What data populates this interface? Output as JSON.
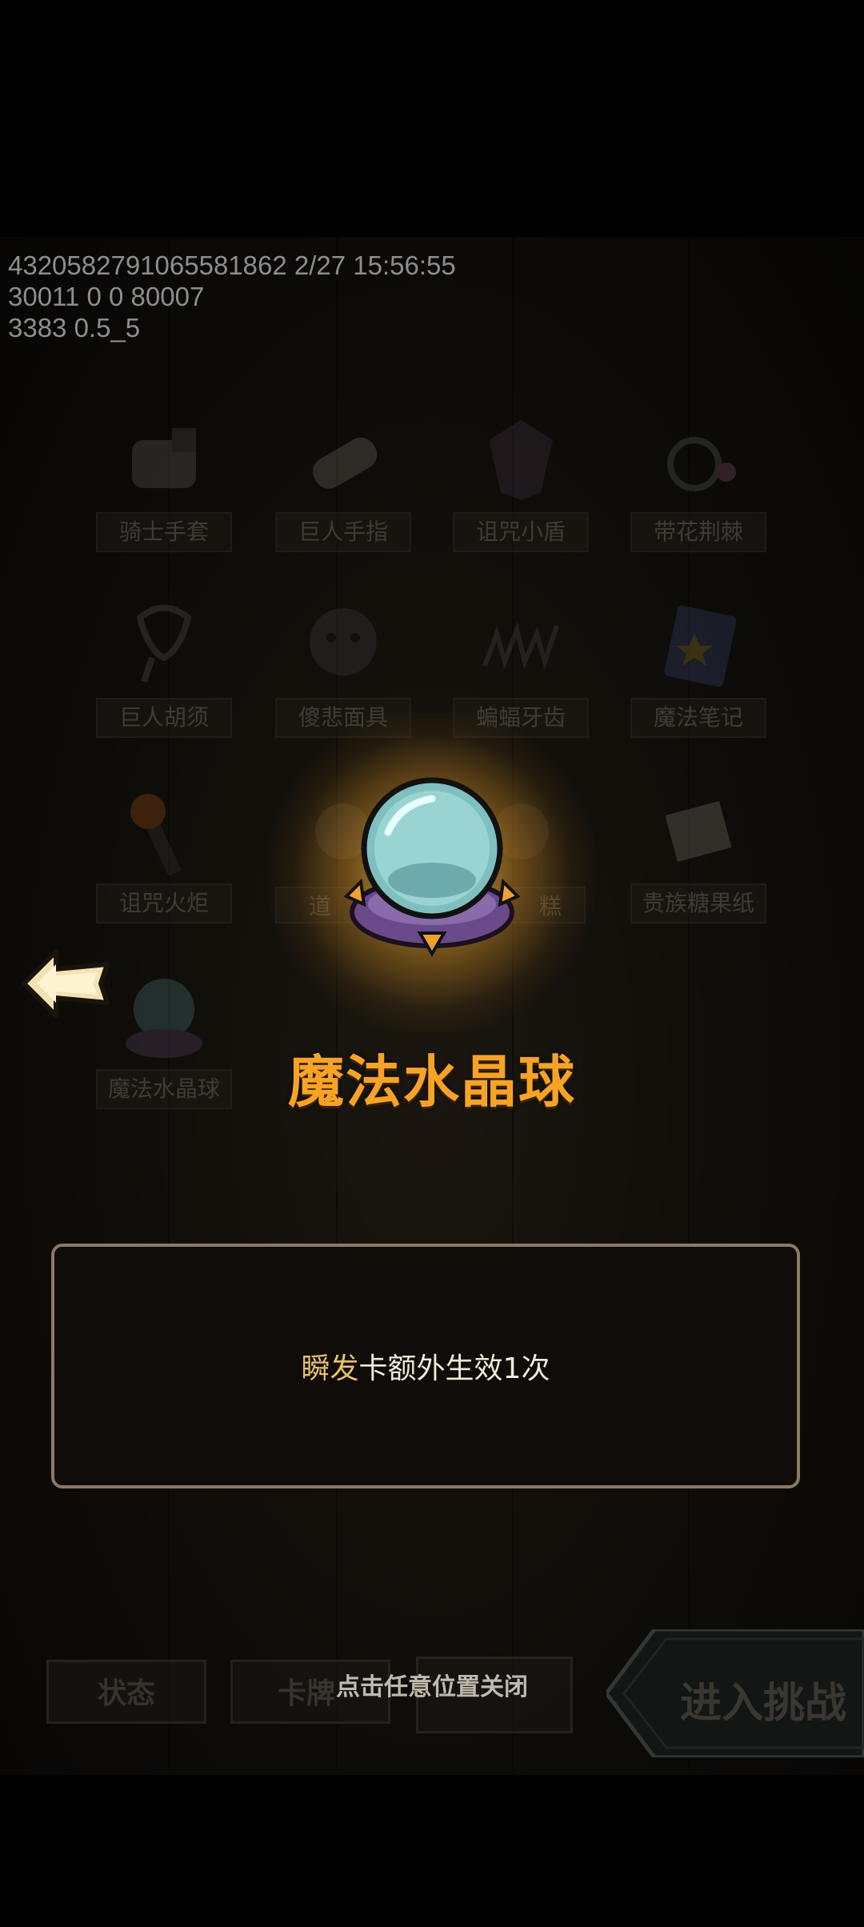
{
  "debug": {
    "line1": "4320582791065581862 2/27 15:56:55",
    "line2": "30011 0 0 80007",
    "line3": "3383 0.5_5"
  },
  "grid_items": [
    {
      "name": "骑士手套",
      "icon": "knight-glove-icon"
    },
    {
      "name": "巨人手指",
      "icon": "giant-finger-icon"
    },
    {
      "name": "诅咒小盾",
      "icon": "cursed-shield-icon"
    },
    {
      "name": "带花荆棘",
      "icon": "flowered-thorn-icon"
    },
    {
      "name": "巨人胡须",
      "icon": "giant-beard-icon"
    },
    {
      "name": "傻悲面具",
      "icon": "sad-mask-icon"
    },
    {
      "name": "蝙蝠牙齿",
      "icon": "bat-teeth-icon"
    },
    {
      "name": "魔法笔记",
      "icon": "magic-notebook-icon"
    },
    {
      "name": "诅咒火炬",
      "icon": "cursed-torch-icon"
    },
    {
      "name": "道",
      "icon": "item-icon"
    },
    {
      "name": "糕",
      "icon": "item-icon"
    },
    {
      "name": "贵族糖果纸",
      "icon": "candy-wrapper-icon"
    },
    {
      "name": "魔法水晶球",
      "icon": "crystal-ball-icon"
    }
  ],
  "popup": {
    "item_name": "魔法水晶球",
    "icon": "crystal-ball-icon",
    "desc_keyword": "瞬发",
    "desc_rest": "卡额外生效1次"
  },
  "close_hint": "点击任意位置关闭",
  "bottom_bar": {
    "status_label": "状态",
    "deck_label": "卡牌",
    "challenge_label": "进入挑战"
  },
  "colors": {
    "title": "#f7a325",
    "keyword": "#e8c06a",
    "box_border": "#8a7a66"
  }
}
